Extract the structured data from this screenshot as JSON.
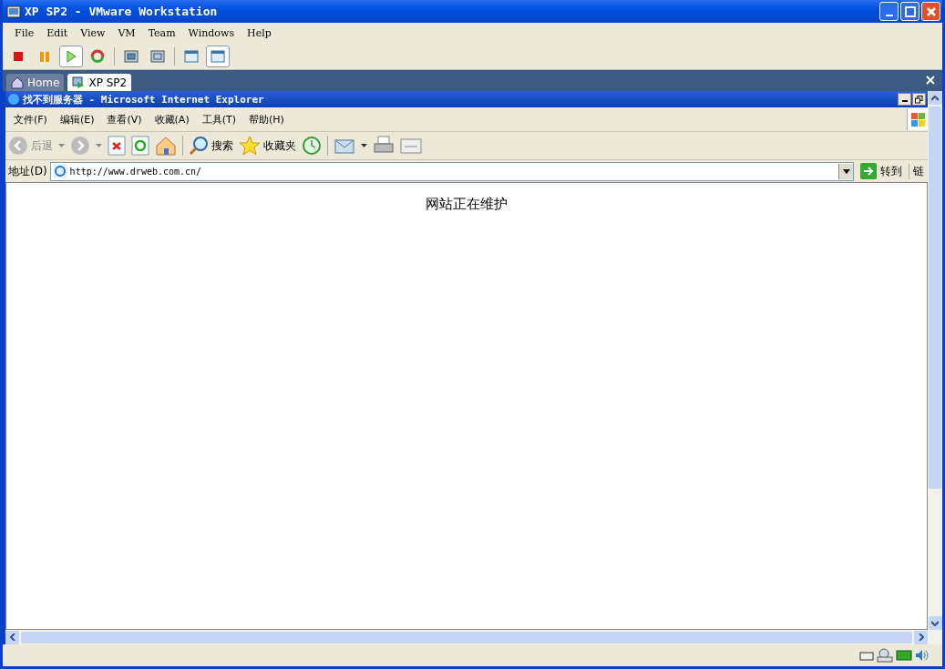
{
  "window": {
    "title": "XP SP2 - VMware Workstation"
  },
  "menu": [
    "File",
    "Edit",
    "View",
    "VM",
    "Team",
    "Windows",
    "Help"
  ],
  "toolbar": [
    {
      "kind": "stop",
      "selected": false
    },
    {
      "kind": "pause",
      "selected": false
    },
    {
      "kind": "play",
      "selected": true
    },
    {
      "kind": "reset",
      "selected": false
    },
    {
      "kind": "sep"
    },
    {
      "kind": "full",
      "selected": false
    },
    {
      "kind": "fit",
      "selected": false
    },
    {
      "kind": "sep"
    },
    {
      "kind": "quick",
      "selected": false
    },
    {
      "kind": "console",
      "selected": true
    }
  ],
  "tabs": [
    {
      "label": "Home",
      "selected": false
    },
    {
      "label": "XP SP2",
      "selected": true
    }
  ],
  "ie": {
    "title": "找不到服务器 - Microsoft Internet Explorer",
    "menu": [
      "文件(F)",
      "编辑(E)",
      "查看(V)",
      "收藏(A)",
      "工具(T)",
      "帮助(H)"
    ],
    "back_label": "后退",
    "search_label": "搜索",
    "favorites_label": "收藏夹",
    "address_label": "地址(D)",
    "address": "http://www.drweb.com.cn/",
    "go_label": "转到",
    "links_label": "链",
    "content": "网站正在维护"
  }
}
